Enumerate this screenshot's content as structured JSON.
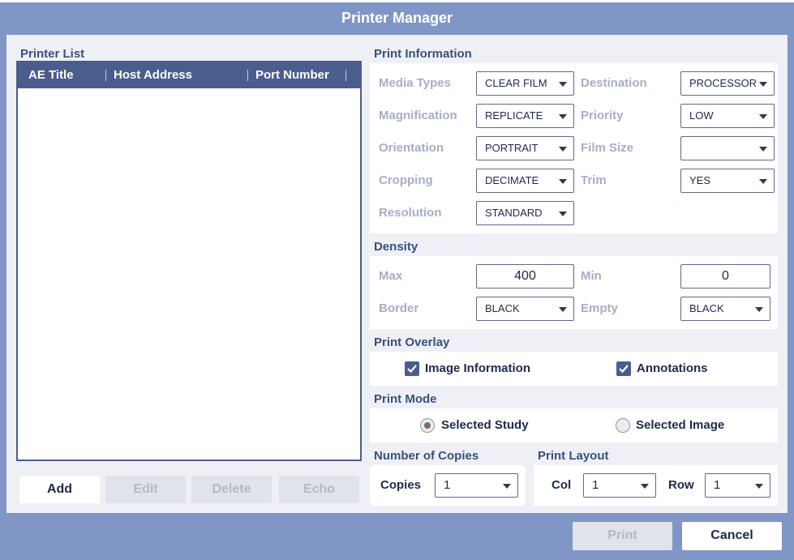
{
  "dialog": {
    "title": "Printer Manager"
  },
  "printer_list": {
    "label": "Printer List",
    "columns": [
      "AE Title",
      "Host Address",
      "Port Number"
    ],
    "rows": []
  },
  "list_buttons": {
    "add": "Add",
    "edit": "Edit",
    "delete": "Delete",
    "echo": "Echo"
  },
  "print_information": {
    "label": "Print Information",
    "media_types": {
      "label": "Media Types",
      "value": "CLEAR FILM"
    },
    "destination": {
      "label": "Destination",
      "value": "PROCESSOR"
    },
    "magnification": {
      "label": "Magnification",
      "value": "REPLICATE"
    },
    "priority": {
      "label": "Priority",
      "value": "LOW"
    },
    "orientation": {
      "label": "Orientation",
      "value": "PORTRAIT"
    },
    "film_size": {
      "label": "Film Size",
      "value": ""
    },
    "cropping": {
      "label": "Cropping",
      "value": "DECIMATE"
    },
    "trim": {
      "label": "Trim",
      "value": "YES"
    },
    "resolution": {
      "label": "Resolution",
      "value": "STANDARD"
    }
  },
  "density": {
    "label": "Density",
    "max": {
      "label": "Max",
      "value": "400"
    },
    "min": {
      "label": "Min",
      "value": "0"
    },
    "border": {
      "label": "Border",
      "value": "BLACK"
    },
    "empty": {
      "label": "Empty",
      "value": "BLACK"
    }
  },
  "print_overlay": {
    "label": "Print Overlay",
    "image_information": {
      "label": "Image Information",
      "checked": true
    },
    "annotations": {
      "label": "Annotations",
      "checked": true
    }
  },
  "print_mode": {
    "label": "Print Mode",
    "selected_study": {
      "label": "Selected Study",
      "selected": true
    },
    "selected_image": {
      "label": "Selected Image",
      "selected": false
    }
  },
  "copies": {
    "label": "Number of Copies",
    "field_label": "Copies",
    "value": "1"
  },
  "print_layout": {
    "label": "Print Layout",
    "col": {
      "label": "Col",
      "value": "1"
    },
    "row": {
      "label": "Row",
      "value": "1"
    }
  },
  "footer": {
    "print": "Print",
    "cancel": "Cancel"
  },
  "colors": {
    "accent": "#4b5d8d",
    "frame": "#8096c6",
    "panel": "#eef0f6",
    "disabled_text": "#b4b8c6"
  },
  "icons": {
    "check": "check-icon",
    "caret": "caret-down-icon"
  }
}
